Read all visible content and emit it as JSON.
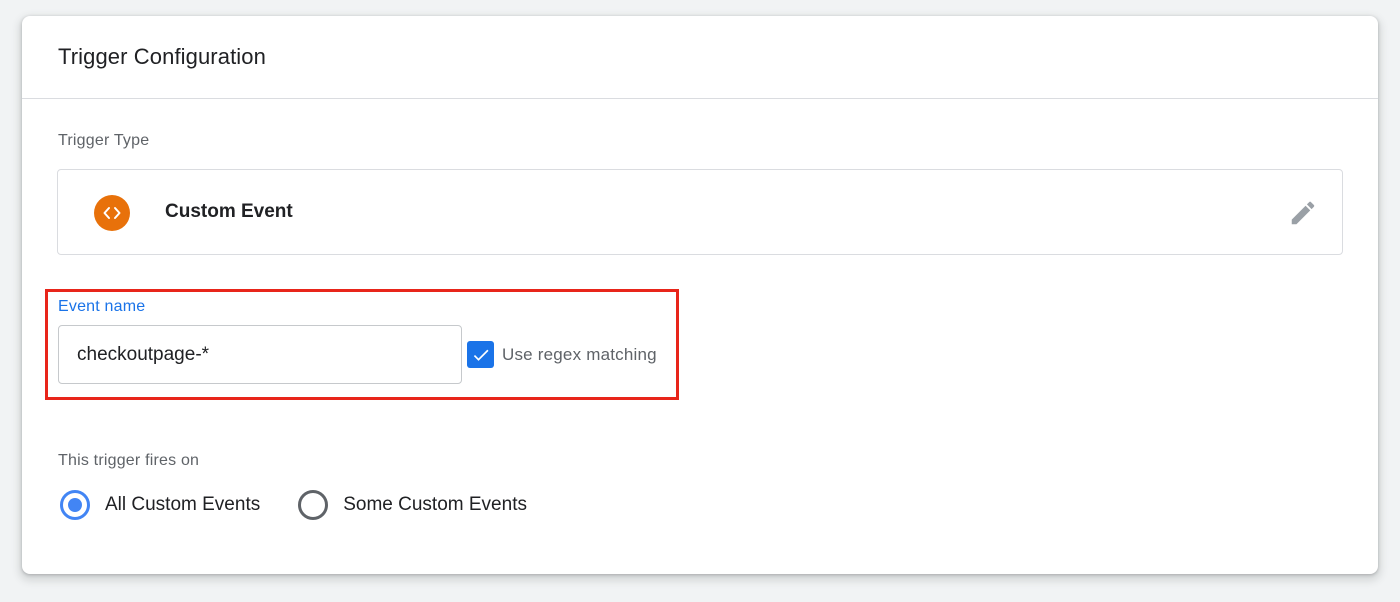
{
  "card": {
    "title": "Trigger Configuration"
  },
  "trigger_type": {
    "label": "Trigger Type",
    "name": "Custom Event",
    "icon": "code-brackets-icon",
    "icon_color": "#e8710a",
    "edit_icon": "pencil-icon"
  },
  "event_name": {
    "label": "Event name",
    "value": "checkoutpage-*",
    "regex_checkbox": {
      "label": "Use regex matching",
      "checked": true
    }
  },
  "fires_on": {
    "label": "This trigger fires on",
    "options": [
      {
        "label": "All Custom Events",
        "selected": true
      },
      {
        "label": "Some Custom Events",
        "selected": false
      }
    ]
  },
  "colors": {
    "accent": "#1a73e8",
    "highlight": "#e8251a",
    "radio": "#4285f4"
  }
}
